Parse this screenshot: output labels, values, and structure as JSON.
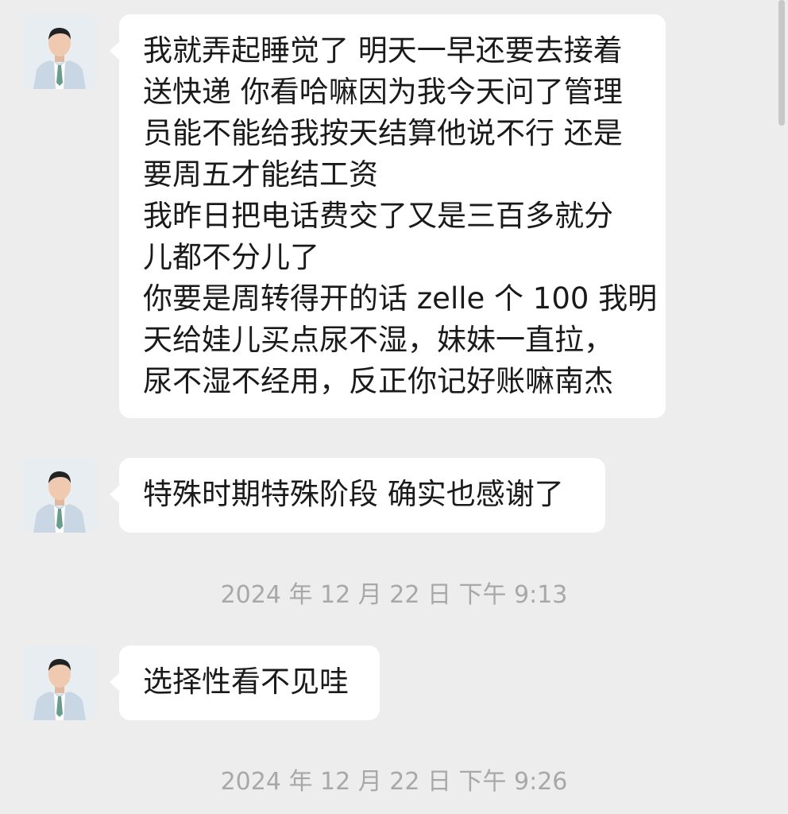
{
  "messages": [
    {
      "lines": [
        "我就弄起睡觉了 明天一早还要去接着",
        "送快递 你看哈嘛因为我今天问了管理",
        "员能不能给我按天结算他说不行 还是",
        "要周五才能结工资",
        "我昨日把电话费交了又是三百多就分",
        "儿都不分儿了",
        "你要是周转得开的话 zelle 个 100 我明",
        "天给娃儿买点尿不湿，妹妹一直拉，",
        "尿不湿不经用，反正你记好账嘛南杰"
      ]
    },
    {
      "lines": [
        "特殊时期特殊阶段 确实也感谢了"
      ]
    },
    {
      "lines": [
        "选择性看不见哇"
      ]
    }
  ],
  "timestamps": [
    "2024 年 12 月 22 日 下午 9:13",
    "2024 年 12 月 22 日 下午 9:26"
  ],
  "colors": {
    "background": "#ededed",
    "bubble": "#ffffff",
    "text": "#1a1a1a",
    "timestamp": "#a8a8a8"
  },
  "icons": {
    "avatar": "avatar"
  }
}
